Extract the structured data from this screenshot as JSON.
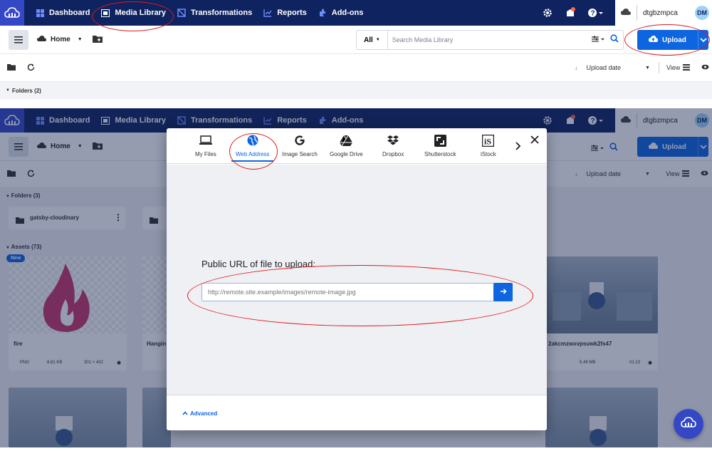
{
  "top_screen": {
    "nav": {
      "items": [
        {
          "label": "Dashboard",
          "icon": "dashboard-icon"
        },
        {
          "label": "Media Library",
          "icon": "media-library-icon"
        },
        {
          "label": "Transformations",
          "icon": "transformations-icon"
        },
        {
          "label": "Reports",
          "icon": "reports-icon"
        },
        {
          "label": "Add-ons",
          "icon": "addons-icon"
        }
      ],
      "account_name": "dtgbzmpca",
      "avatar_initials": "DM"
    },
    "toolbar": {
      "breadcrumb": "Home",
      "search_scope": "All",
      "search_placeholder": "Search Media Library",
      "upload_label": "Upload"
    },
    "subbar": {
      "sort_label": "Upload date",
      "view_label": "View"
    },
    "folders_label": "Folders (2)"
  },
  "bottom_screen": {
    "nav": {
      "items": [
        {
          "label": "Dashboard"
        },
        {
          "label": "Media Library"
        },
        {
          "label": "Transformations"
        },
        {
          "label": "Reports"
        },
        {
          "label": "Add-ons"
        }
      ],
      "account_name": "dtgbzmpca",
      "avatar_initials": "DM"
    },
    "toolbar": {
      "breadcrumb": "Home",
      "upload_label": "Upload"
    },
    "subbar": {
      "sort_label": "Upload date",
      "view_label": "View"
    },
    "folders_label": "Folders (3)",
    "folder_card": "gatsby-cloudinary",
    "assets_label": "Assets (73)",
    "new_badge": "New",
    "assets": [
      {
        "name": "fire",
        "format": "PNG",
        "size": "8.81 KB",
        "dims": "301 × 432"
      },
      {
        "name": "Hangin"
      },
      {
        "name": "2akcmzwxvpsuwk2fs47",
        "size": "5.49 MB",
        "duration": "01:13"
      }
    ]
  },
  "upload_dialog": {
    "tabs": [
      {
        "label": "My Files",
        "icon": "laptop-icon"
      },
      {
        "label": "Web Address",
        "icon": "globe-icon",
        "active": true
      },
      {
        "label": "Image Search",
        "icon": "google-g-icon"
      },
      {
        "label": "Google Drive",
        "icon": "google-drive-icon"
      },
      {
        "label": "Dropbox",
        "icon": "dropbox-icon"
      },
      {
        "label": "Shutterstock",
        "icon": "shutterstock-icon"
      },
      {
        "label": "iStock",
        "icon": "istock-icon"
      }
    ],
    "url_label": "Public URL of file to upload:",
    "url_placeholder": "http://remote.site.example/images/remote-image.jpg",
    "advanced_label": "Advanced"
  },
  "colors": {
    "nav_bg": "#0f2360",
    "brand_blue": "#0d65e0",
    "annotation_red": "#e01919"
  }
}
